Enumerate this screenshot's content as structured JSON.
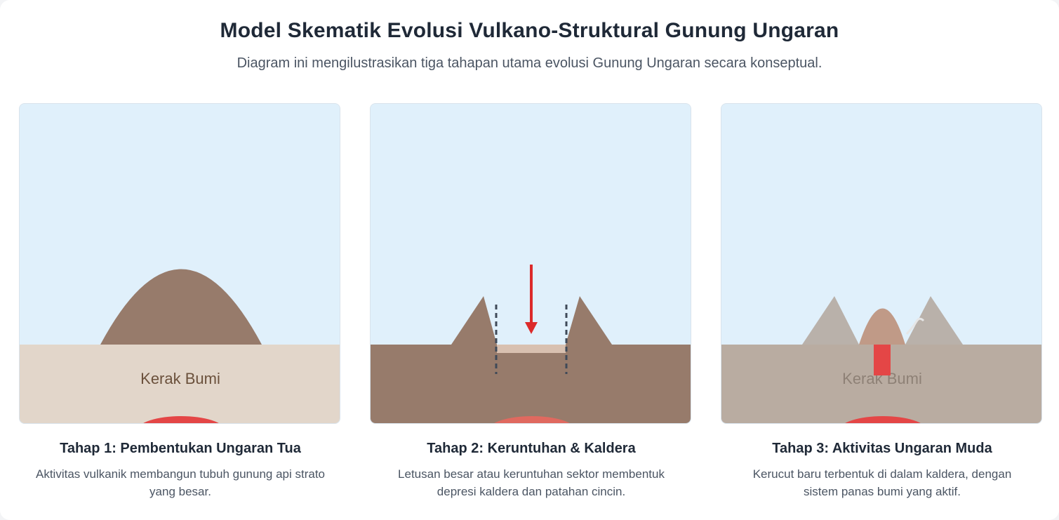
{
  "header": {
    "title": "Model Skematik Evolusi Vulkano-Struktural Gunung Ungaran",
    "subtitle": "Diagram ini mengilustrasikan tiga tahapan utama evolusi Gunung Ungaran secara konseptual."
  },
  "stages": [
    {
      "title": "Tahap 1: Pembentukan Ungaran Tua",
      "desc_line1": "Aktivitas vulkanik membangun tubuh gunung api strato",
      "desc_line2": "yang besar.",
      "crust_label": "Kerak Bumi"
    },
    {
      "title": "Tahap 2: Keruntuhan & Kaldera",
      "desc_line1": "Letusan besar atau keruntuhan sektor membentuk",
      "desc_line2": "depresi kaldera dan patahan cincin."
    },
    {
      "title": "Tahap 3: Aktivitas Ungaran Muda",
      "desc_line1": "Kerucut baru terbentuk di dalam kaldera, dengan",
      "desc_line2": "sistem panas bumi yang aktif.",
      "crust_label": "Kerak Bumi"
    }
  ],
  "colors": {
    "sky": "#e0f0fb",
    "crust_light": "#e2d6ca",
    "crust_dark": "#977b6b",
    "crust_gray": "#b9aca1",
    "mountain": "#977b6b",
    "magma": "#e44646",
    "arrow": "#dc2a2a",
    "fault": "#3f4a58"
  },
  "icons": [
    "arrow-down-icon",
    "fault-line-icon"
  ]
}
